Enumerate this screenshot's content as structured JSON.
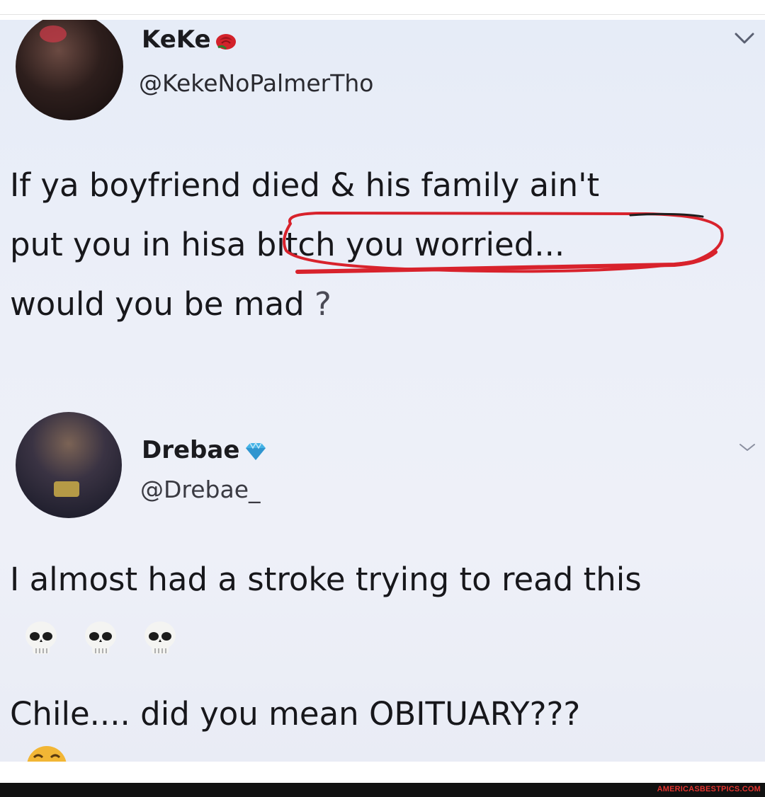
{
  "tweets": [
    {
      "display_name": "KeKe",
      "handle": "@KekeNoPalmerTho",
      "badge_icon": "rose-icon",
      "body_lines": [
        "If ya boyfriend died & his family ain't",
        "put you in his",
        "a bitch you worried...",
        "would you be mad",
        " ?"
      ],
      "annotation": {
        "type": "hand-drawn circle",
        "color": "#d8222c",
        "around": "a bitch you worried..."
      }
    },
    {
      "display_name": "Drebae",
      "handle": "@Drebae_",
      "badge_icon": "diamond-icon",
      "body_lines": [
        "I almost had a stroke trying to read this",
        "Chile.... did you mean OBITUARY???"
      ],
      "emojis": [
        "skull-icon",
        "skull-icon",
        "skull-icon"
      ],
      "trailing_emoji": "laughing-face-icon"
    }
  ],
  "footer": {
    "brand": "AMERICASBESTPICS.COM",
    "brand_color": "#e3342f"
  },
  "colors": {
    "screenshot_bg": "#eceff8",
    "text": "#17171b",
    "annotation_red": "#d8222c",
    "footer_bg": "#111111"
  }
}
